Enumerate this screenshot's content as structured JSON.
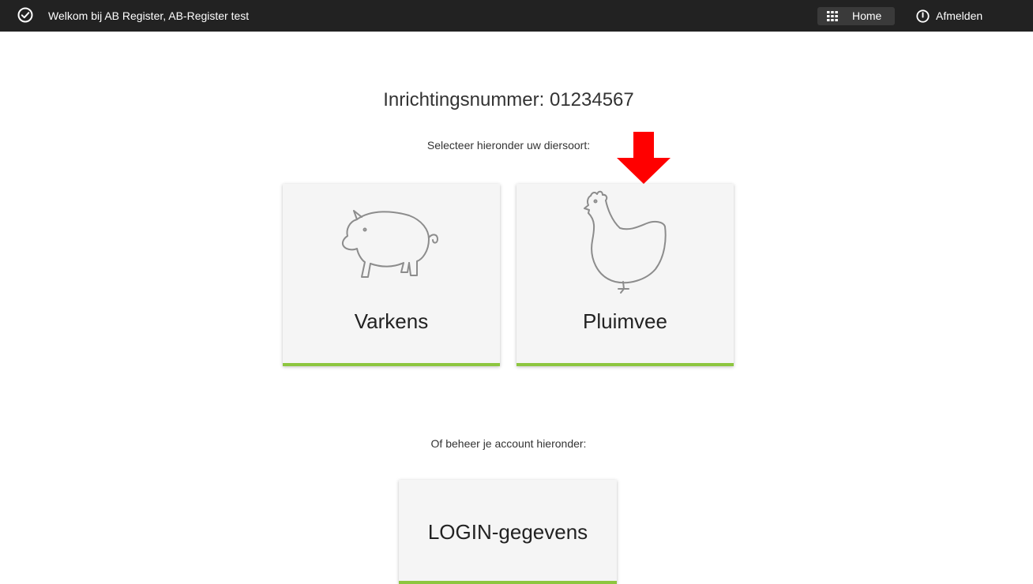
{
  "topbar": {
    "welcome_text": "Welkom bij AB Register, AB-Register test",
    "home_label": "Home",
    "logout_label": "Afmelden",
    "background_color": "#222222",
    "icons": {
      "left": "check-circle-icon",
      "home": "grid-icon",
      "logout": "power-icon"
    }
  },
  "main": {
    "heading": "Inrichtingsnummer: 01234567",
    "select_prompt": "Selecteer hieronder uw diersoort:",
    "account_prompt": "Of beheer je account hieronder:",
    "cards": [
      {
        "label": "Varkens",
        "icon": "pig-icon"
      },
      {
        "label": "Pluimvee",
        "icon": "chicken-icon"
      }
    ],
    "login_card": {
      "label": "LOGIN-gegevens"
    },
    "annotation": {
      "icon": "arrow-down-icon",
      "color": "#ff0000"
    },
    "accent_color": "#8dc63f"
  }
}
